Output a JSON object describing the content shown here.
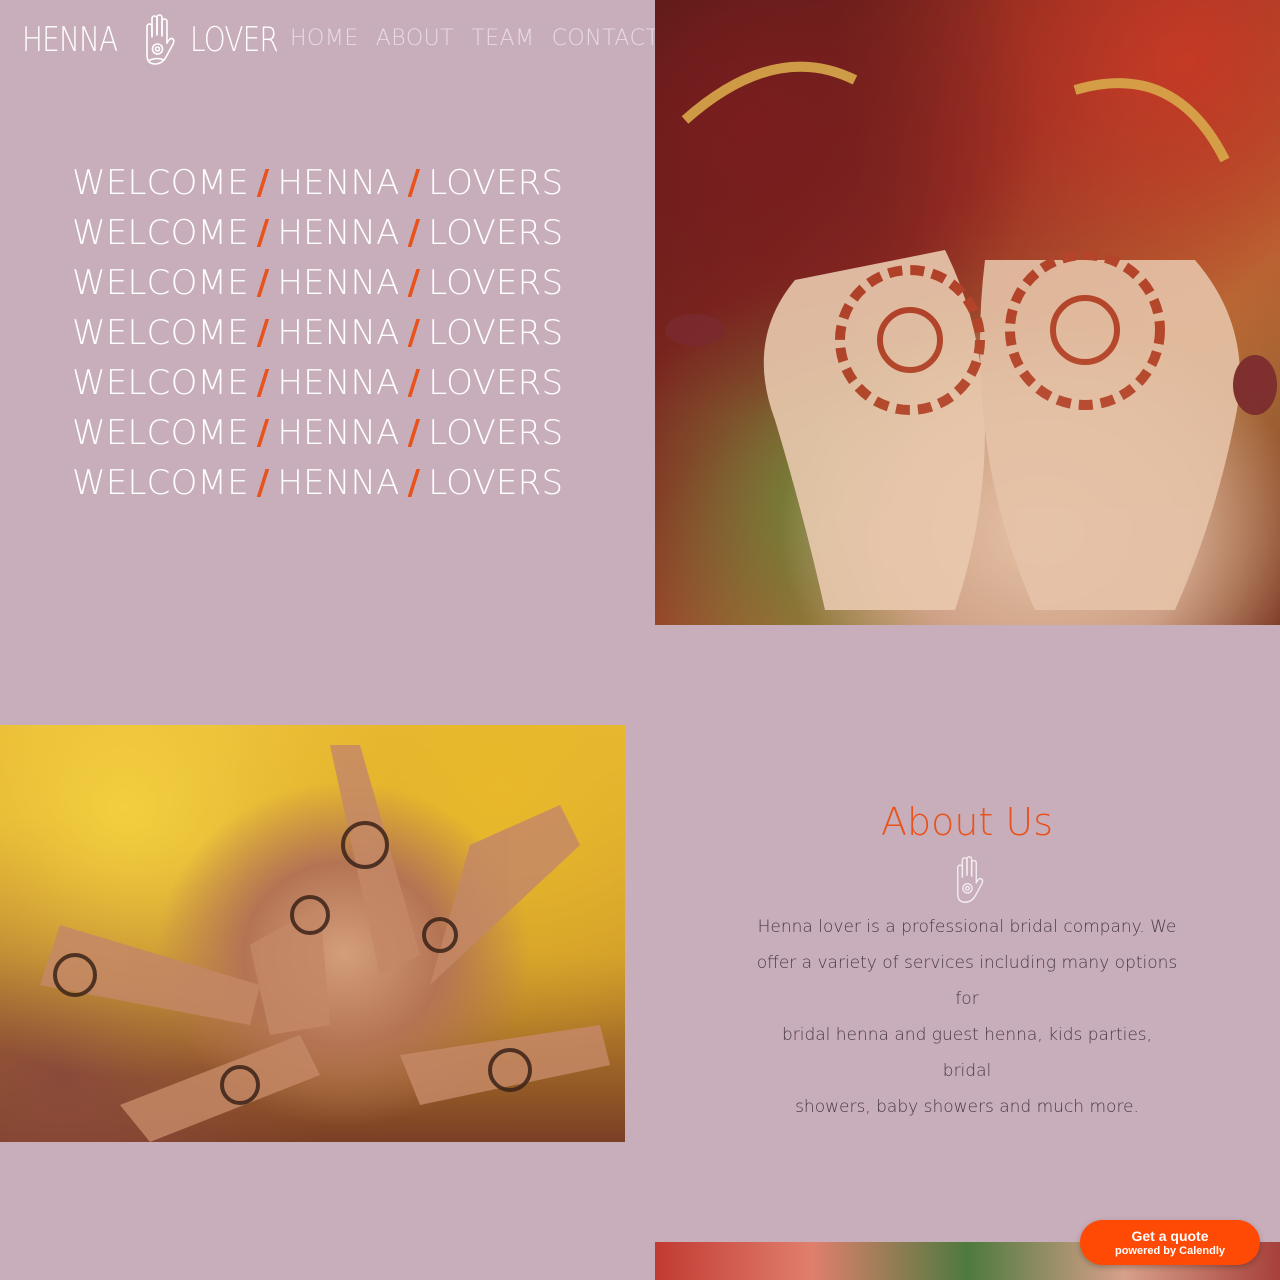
{
  "header": {
    "logo_left": "HENNA",
    "logo_right": "LOVER",
    "nav": [
      {
        "label": "HOME"
      },
      {
        "label": "ABOUT"
      },
      {
        "label": "TEAM"
      },
      {
        "label": "CONTACT"
      }
    ]
  },
  "hero": {
    "lines": [
      {
        "w1": "WELCOME",
        "w2": "HENNA",
        "w3": "LOVERS"
      },
      {
        "w1": "WELCOME",
        "w2": "HENNA",
        "w3": "LOVERS"
      },
      {
        "w1": "WELCOME",
        "w2": "HENNA",
        "w3": "LOVERS"
      },
      {
        "w1": "WELCOME",
        "w2": "HENNA",
        "w3": "LOVERS"
      },
      {
        "w1": "WELCOME",
        "w2": "HENNA",
        "w3": "LOVERS"
      },
      {
        "w1": "WELCOME",
        "w2": "HENNA",
        "w3": "LOVERS"
      },
      {
        "w1": "WELCOME",
        "w2": "HENNA",
        "w3": "LOVERS"
      }
    ],
    "separator": "/"
  },
  "about": {
    "title": "About Us",
    "text_lines": [
      "Henna lover is a professional bridal company. We",
      "offer a variety of services including many options for",
      "bridal henna and guest henna, kids parties, bridal",
      "showers, baby showers and much more."
    ]
  },
  "badge": {
    "main": "Get a quote",
    "sub": "powered by Calendly"
  },
  "colors": {
    "background": "#c8aebb",
    "accent": "#e8521b",
    "badge": "#ff4a06"
  },
  "icons": [
    "hamsa-hand-icon"
  ]
}
